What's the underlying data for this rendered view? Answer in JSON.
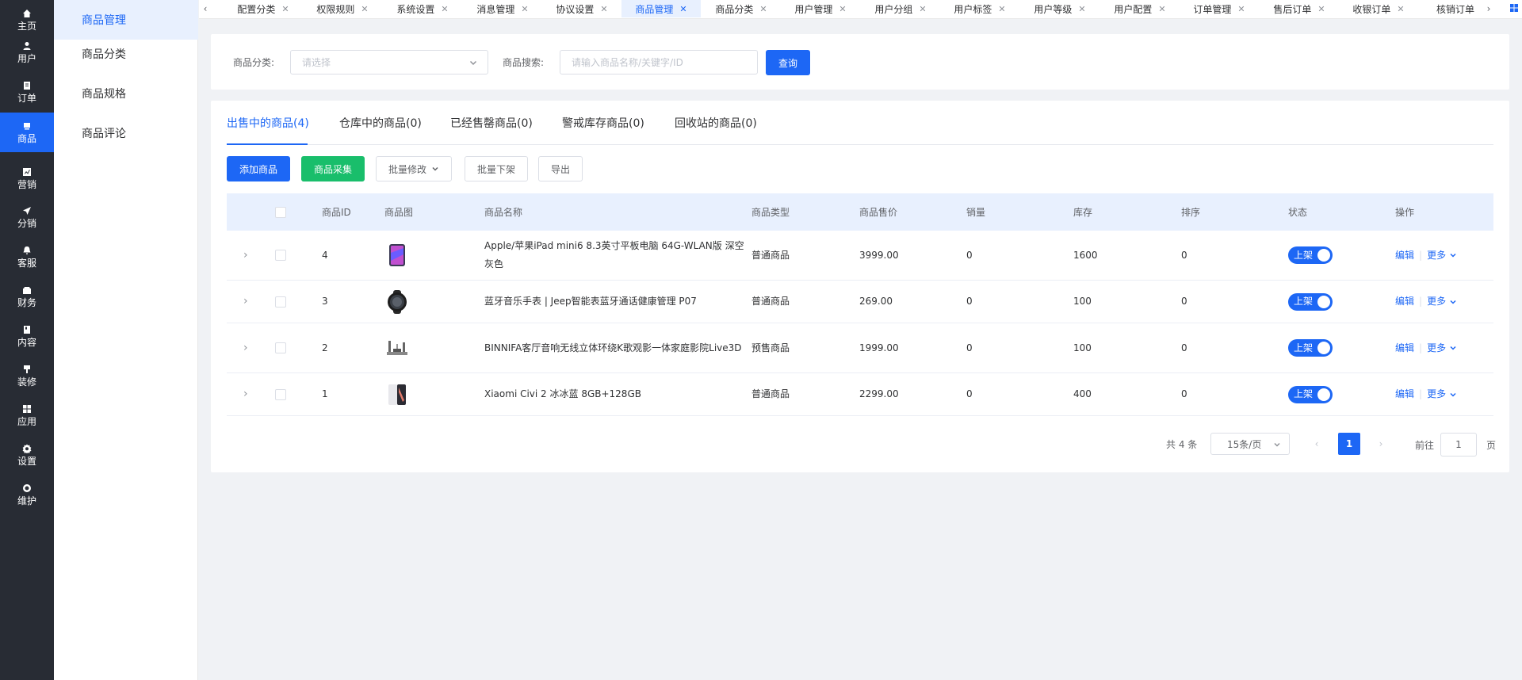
{
  "sidebar": {
    "items": [
      {
        "label": "主页",
        "icon": "home-icon"
      },
      {
        "label": "用户",
        "icon": "user-icon"
      },
      {
        "label": "订单",
        "icon": "order-icon"
      },
      {
        "label": "商品",
        "icon": "product-icon",
        "active": true
      },
      {
        "label": "营销",
        "icon": "marketing-icon"
      },
      {
        "label": "分销",
        "icon": "distribution-icon"
      },
      {
        "label": "客服",
        "icon": "service-icon"
      },
      {
        "label": "财务",
        "icon": "finance-icon"
      },
      {
        "label": "内容",
        "icon": "content-icon"
      },
      {
        "label": "装修",
        "icon": "decoration-icon"
      },
      {
        "label": "应用",
        "icon": "apps-icon"
      },
      {
        "label": "设置",
        "icon": "settings-icon"
      },
      {
        "label": "维护",
        "icon": "maintenance-icon"
      }
    ]
  },
  "submenu": {
    "items": [
      {
        "label": "商品管理",
        "active": true
      },
      {
        "label": "商品分类"
      },
      {
        "label": "商品规格"
      },
      {
        "label": "商品评论"
      }
    ]
  },
  "tabs": [
    {
      "label": "配置分类"
    },
    {
      "label": "权限规则"
    },
    {
      "label": "系统设置"
    },
    {
      "label": "消息管理"
    },
    {
      "label": "协议设置"
    },
    {
      "label": "商品管理",
      "active": true
    },
    {
      "label": "商品分类"
    },
    {
      "label": "用户管理"
    },
    {
      "label": "用户分组"
    },
    {
      "label": "用户标签"
    },
    {
      "label": "用户等级"
    },
    {
      "label": "用户配置"
    },
    {
      "label": "订单管理"
    },
    {
      "label": "售后订单"
    },
    {
      "label": "收银订单"
    },
    {
      "label": "核销订单"
    }
  ],
  "search": {
    "category_label": "商品分类:",
    "category_placeholder": "请选择",
    "keyword_label": "商品搜索:",
    "keyword_placeholder": "请输入商品名称/关键字/ID",
    "query_button": "查询"
  },
  "product_tabs": [
    {
      "label": "出售中的商品(4)",
      "active": true
    },
    {
      "label": "仓库中的商品(0)"
    },
    {
      "label": "已经售罄商品(0)"
    },
    {
      "label": "警戒库存商品(0)"
    },
    {
      "label": "回收站的商品(0)"
    }
  ],
  "actions": {
    "add": "添加商品",
    "collect": "商品采集",
    "batch_edit": "批量修改",
    "batch_offshelf": "批量下架",
    "export": "导出"
  },
  "table": {
    "columns": [
      "商品ID",
      "商品图",
      "商品名称",
      "商品类型",
      "商品售价",
      "销量",
      "库存",
      "排序",
      "状态",
      "操作"
    ],
    "rows": [
      {
        "id": "4",
        "thumb": "tablet-thumb",
        "name": "Apple/苹果iPad mini6 8.3英寸平板电脑 64G-WLAN版 深空灰色",
        "type": "普通商品",
        "price": "3999.00",
        "sales": "0",
        "stock": "1600",
        "sort": "0",
        "status": "上架"
      },
      {
        "id": "3",
        "thumb": "watch-thumb",
        "name": "蓝牙音乐手表 | Jeep智能表蓝牙通话健康管理 P07",
        "type": "普通商品",
        "price": "269.00",
        "sales": "0",
        "stock": "100",
        "sort": "0",
        "status": "上架"
      },
      {
        "id": "2",
        "thumb": "speaker-thumb",
        "name": "BINNIFA客厅音响无线立体环绕K歌观影一体家庭影院Live3D",
        "type": "预售商品",
        "price": "1999.00",
        "sales": "0",
        "stock": "100",
        "sort": "0",
        "status": "上架"
      },
      {
        "id": "1",
        "thumb": "phone-thumb",
        "name": "Xiaomi Civi 2 冰冰蓝 8GB+128GB",
        "type": "普通商品",
        "price": "2299.00",
        "sales": "0",
        "stock": "400",
        "sort": "0",
        "status": "上架"
      }
    ],
    "op_edit": "编辑",
    "op_more": "更多"
  },
  "pagination": {
    "total": "共 4 条",
    "page_size": "15条/页",
    "current": "1",
    "goto_prefix": "前往",
    "goto_value": "1",
    "goto_suffix": "页"
  },
  "colors": {
    "primary": "#1d67f5",
    "success": "#19be6b",
    "sidebar": "#282c34"
  }
}
